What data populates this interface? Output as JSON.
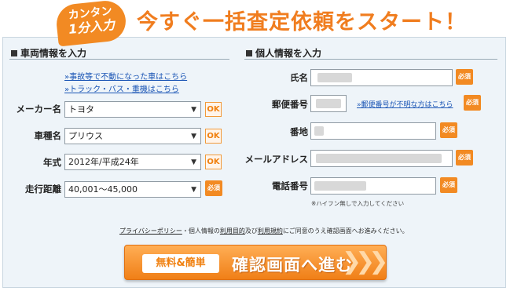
{
  "header": {
    "badge_line1": "カンタン",
    "badge_line2": "1分入力",
    "headline": "今すぐ一括査定依頼をスタート！"
  },
  "vehicle": {
    "section_title": "車両情報を入力",
    "links": [
      "»事故等で不動になった車はこちら",
      "»トラック・バス・重機はこちら"
    ],
    "maker": {
      "label": "メーカー名",
      "value": "トヨタ",
      "button": "OK"
    },
    "model": {
      "label": "車種名",
      "value": "プリウス",
      "button": "OK"
    },
    "year": {
      "label": "年式",
      "value": "2012年/平成24年",
      "button": "OK"
    },
    "mileage": {
      "label": "走行距離",
      "value": "40,001～45,000",
      "badge": "必須"
    }
  },
  "personal": {
    "section_title": "個人情報を入力",
    "name": {
      "label": "氏名",
      "badge": "必須"
    },
    "postal": {
      "label": "郵便番号",
      "link": "»郵便番号が不明な方はこちら",
      "badge": "必須"
    },
    "address": {
      "label": "番地",
      "badge": "必須"
    },
    "email": {
      "label": "メールアドレス",
      "badge": "必須"
    },
    "phone": {
      "label": "電話番号",
      "badge": "必須",
      "note": "※ハイフン無しで入力してください"
    }
  },
  "consent": {
    "privacy": "プライバシーポリシー",
    "mid1": "・個人情報の",
    "usage": "利用目的",
    "mid2": "及び",
    "terms": "利用規約",
    "tail": "にご同意のうえ確認画面へお進みください。"
  },
  "submit": {
    "tag": "無料&簡単",
    "label": "確認画面へ進む",
    "chevrons": "❯❯❯"
  },
  "colors": {
    "accent": "#f28a23",
    "link": "#1a55b5",
    "panel": "#eef4f9"
  }
}
